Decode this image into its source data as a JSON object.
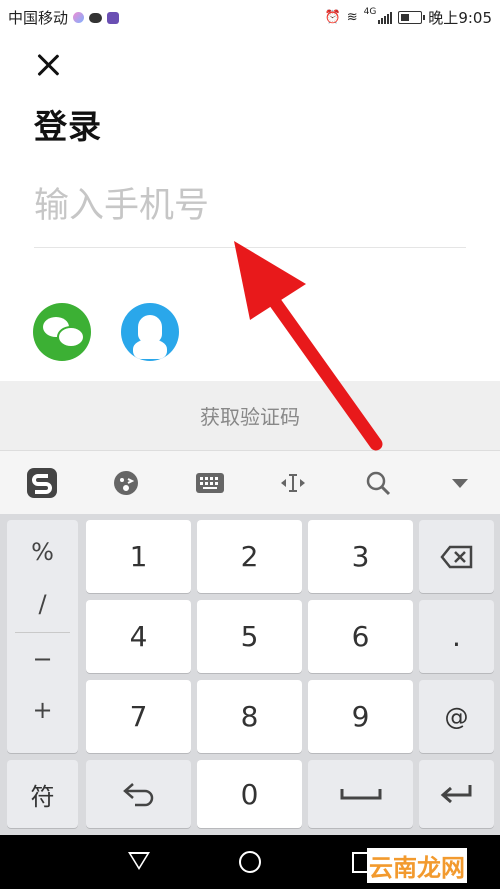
{
  "status_bar": {
    "carrier": "中国移动",
    "network": "4G",
    "time_prefix": "晚上",
    "time": "9:05"
  },
  "login": {
    "title": "登录",
    "phone_placeholder": "输入手机号",
    "phone_value": "",
    "get_code_label": "获取验证码",
    "social": [
      "wechat-icon",
      "qq-icon"
    ]
  },
  "keyboard": {
    "toolbar": [
      "sogou-logo-icon",
      "emoji-icon",
      "keyboard-icon",
      "cursor-move-icon",
      "search-icon",
      "collapse-icon"
    ],
    "symbols": [
      "%",
      "/",
      "−",
      "+"
    ],
    "digits": [
      "1",
      "2",
      "3",
      "4",
      "5",
      "6",
      "7",
      "8",
      "9",
      "0"
    ],
    "dot": ".",
    "at": "@",
    "symbol_key": "符"
  },
  "watermark": "云南龙网",
  "colors": {
    "wechat": "#3cb034",
    "qq": "#2aa7ea",
    "arrow": "#e8191b",
    "watermark": "#f29a2e"
  }
}
